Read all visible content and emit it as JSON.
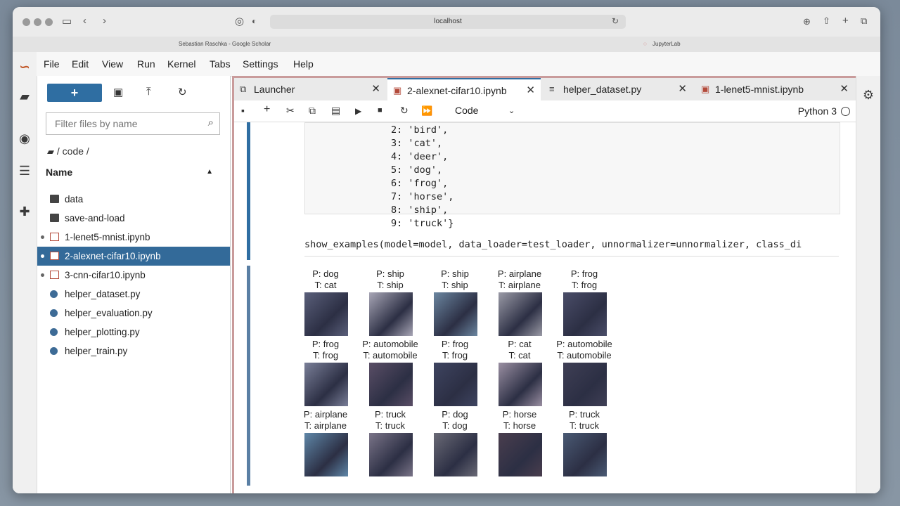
{
  "browser": {
    "url": "localhost",
    "tab1": "Sebastian Raschka - Google Scholar",
    "tab2": "JupyterLab"
  },
  "menu": [
    "File",
    "Edit",
    "View",
    "Run",
    "Kernel",
    "Tabs",
    "Settings",
    "Help"
  ],
  "filebrowser": {
    "filter_placeholder": "Filter files by name",
    "breadcrumb": "/ code /",
    "column_header": "Name",
    "files": [
      {
        "name": "data",
        "type": "folder",
        "running": false,
        "selected": false
      },
      {
        "name": "save-and-load",
        "type": "folder",
        "running": false,
        "selected": false
      },
      {
        "name": "1-lenet5-mnist.ipynb",
        "type": "notebook",
        "running": true,
        "selected": false
      },
      {
        "name": "2-alexnet-cifar10.ipynb",
        "type": "notebook",
        "running": true,
        "selected": true
      },
      {
        "name": "3-cnn-cifar10.ipynb",
        "type": "notebook",
        "running": true,
        "selected": false
      },
      {
        "name": "helper_dataset.py",
        "type": "python",
        "running": false,
        "selected": false
      },
      {
        "name": "helper_evaluation.py",
        "type": "python",
        "running": false,
        "selected": false
      },
      {
        "name": "helper_plotting.py",
        "type": "python",
        "running": false,
        "selected": false
      },
      {
        "name": "helper_train.py",
        "type": "python",
        "running": false,
        "selected": false
      }
    ]
  },
  "tabs": [
    {
      "label": "Launcher",
      "active": false
    },
    {
      "label": "2-alexnet-cifar10.ipynb",
      "active": true
    },
    {
      "label": "helper_dataset.py",
      "active": false
    },
    {
      "label": "1-lenet5-mnist.ipynb",
      "active": false
    }
  ],
  "toolbar": {
    "cell_type": "Code",
    "kernel": "Python 3"
  },
  "output_lines": [
    "2: 'bird',",
    "3: 'cat',",
    "4: 'deer',",
    "5: 'dog',",
    "6: 'frog',",
    "7: 'horse',",
    "8: 'ship',",
    "9: 'truck'}"
  ],
  "input_line": "show_examples(model=model, data_loader=test_loader, unnormalizer=unnormalizer, class_di",
  "examples": [
    {
      "p": "P: dog",
      "t": "T: cat",
      "color": "#5a5f7a"
    },
    {
      "p": "P: ship",
      "t": "T: ship",
      "color": "#a8a6b6"
    },
    {
      "p": "P: ship",
      "t": "T: ship",
      "color": "#6b86a0"
    },
    {
      "p": "P: airplane",
      "t": "T: airplane",
      "color": "#9a9aa6"
    },
    {
      "p": "P: frog",
      "t": "T: frog",
      "color": "#4a4d68"
    },
    {
      "p": "P: frog",
      "t": "T: frog",
      "color": "#7a7f98"
    },
    {
      "p": "P: automobile",
      "t": "T: automobile",
      "color": "#5a4e66"
    },
    {
      "p": "P: frog",
      "t": "T: frog",
      "color": "#3e4460"
    },
    {
      "p": "P: cat",
      "t": "T: cat",
      "color": "#9a8fa2"
    },
    {
      "p": "P: automobile",
      "t": "T: automobile",
      "color": "#3f3f55"
    },
    {
      "p": "P: airplane",
      "t": "T: airplane",
      "color": "#5f87a8"
    },
    {
      "p": "P: truck",
      "t": "T: truck",
      "color": "#7a7488"
    },
    {
      "p": "P: dog",
      "t": "T: dog",
      "color": "#6a6a76"
    },
    {
      "p": "P: horse",
      "t": "T: horse",
      "color": "#4a3e4e"
    },
    {
      "p": "P: truck",
      "t": "T: truck",
      "color": "#4a5a74"
    }
  ]
}
